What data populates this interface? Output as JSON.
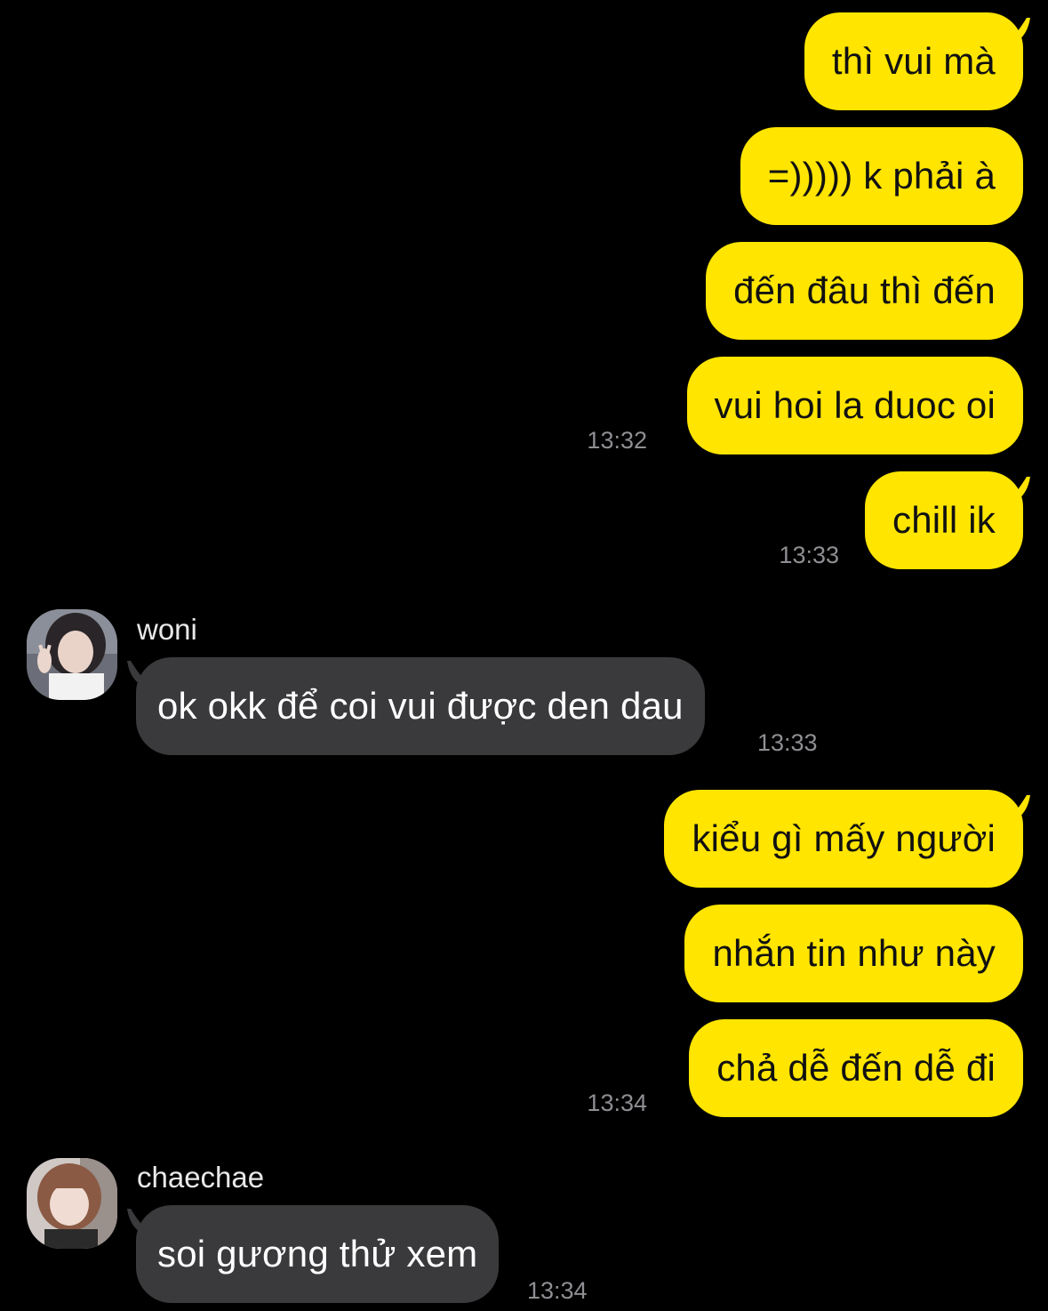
{
  "messages": [
    {
      "sender": "me",
      "text": "thì vui mà"
    },
    {
      "sender": "me",
      "text": "=))))) k phải à"
    },
    {
      "sender": "me",
      "text": "đến đâu thì đến"
    },
    {
      "sender": "me",
      "text": "vui hoi la duoc oi",
      "time": "13:32"
    },
    {
      "sender": "me",
      "text": "chill ik",
      "time": "13:33"
    },
    {
      "sender": "woni",
      "text": "ok okk để coi vui được den dau",
      "time": "13:33"
    },
    {
      "sender": "me",
      "text": "kiểu gì mấy người"
    },
    {
      "sender": "me",
      "text": "nhắn tin như này"
    },
    {
      "sender": "me",
      "text": "chả dễ đến dễ đi",
      "time": "13:34"
    },
    {
      "sender": "chaechae",
      "text": "soi gương thử xem",
      "time": "13:34"
    }
  ],
  "colors": {
    "background": "#000000",
    "my_bubble": "#FFE500",
    "their_bubble": "#3A3A3C",
    "timestamp": "#8E8E93"
  },
  "icons": {
    "woni_avatar": "profile-photo",
    "chaechae_avatar": "profile-photo"
  }
}
